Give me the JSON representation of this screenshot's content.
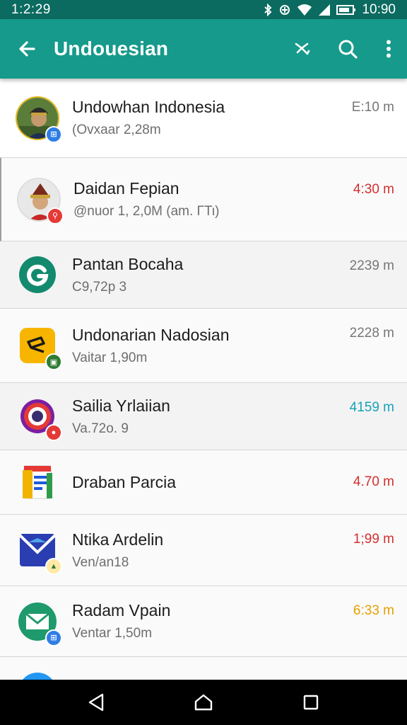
{
  "status_bar": {
    "time_left": "1:2:29",
    "time_right": "10:90"
  },
  "app_bar": {
    "title": "Undouesian"
  },
  "colors": {
    "primary": "#169a8b",
    "primary_dark": "#0b6b60",
    "time_red": "#d32f2f",
    "time_teal": "#17a2b8",
    "time_orange": "#e6a000"
  },
  "items": [
    {
      "name": "Undowhan Indonesia",
      "sub": "(Ovxaar 2,28m",
      "time": "Ε:10 m"
    },
    {
      "name": "Daidan Fepian",
      "sub": "@nuor 1, 2,0M (am. ΓΤι)",
      "time": "4:30 m"
    },
    {
      "name": "Pantan Bocaha",
      "sub": "C9,72p 3",
      "time": "2239 m"
    },
    {
      "name": "Undonarian Nadosian",
      "sub": "Vaitar 1,90m",
      "time": "2228 m"
    },
    {
      "name": "Sailia Yrlaiian",
      "sub": "Va.72o. 9",
      "time": "4159 m"
    },
    {
      "name": "Draban Parcia",
      "sub": "",
      "time": "4.70 m"
    },
    {
      "name": "Ntika Ardelin",
      "sub": "Ven/an18",
      "time": "1;99 m"
    },
    {
      "name": "Radam Vpain",
      "sub": "Ventar 1,50m",
      "time": "6:33 m"
    }
  ]
}
